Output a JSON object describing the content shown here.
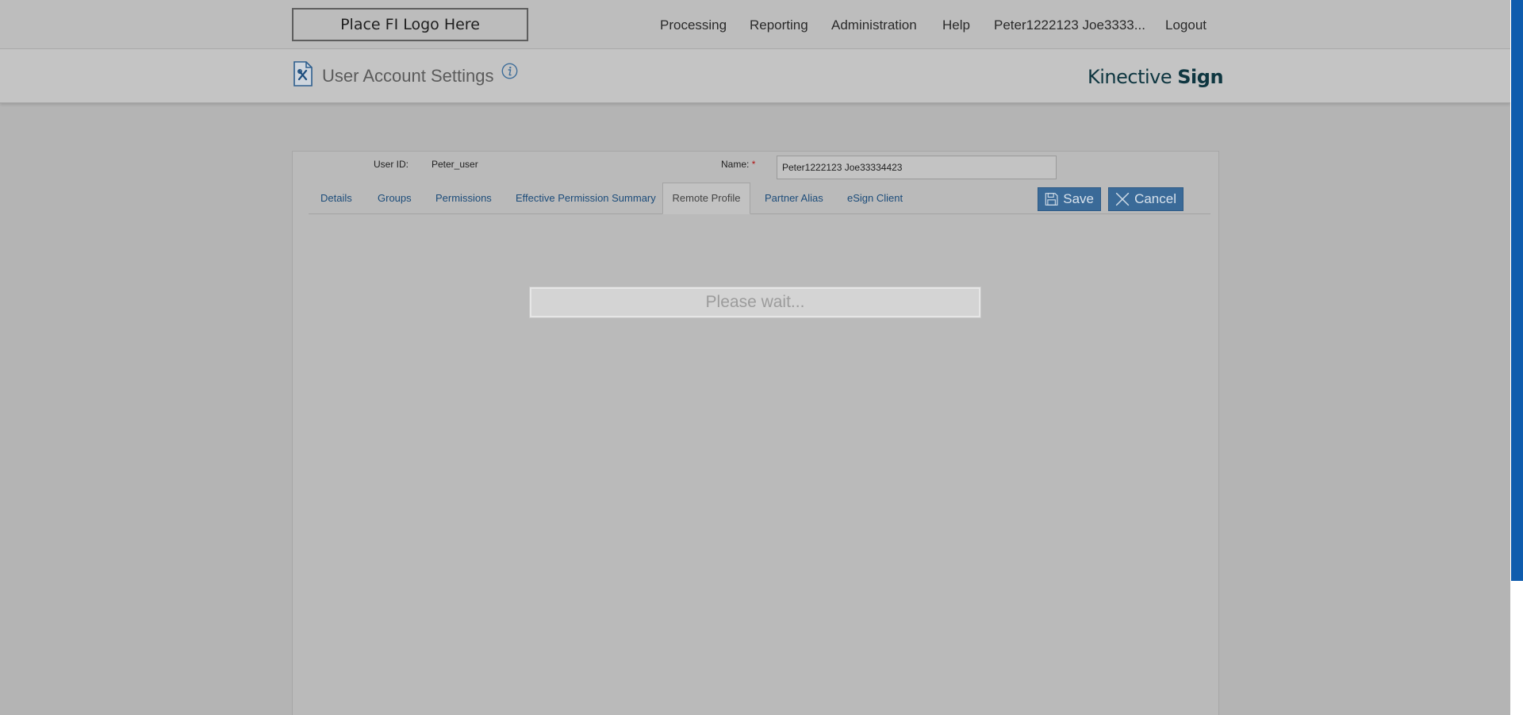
{
  "topbar": {
    "logo_text": "Place FI Logo Here",
    "nav": [
      {
        "label": "Processing"
      },
      {
        "label": "Reporting"
      },
      {
        "label": "Administration"
      },
      {
        "label": "Help"
      },
      {
        "label": "Peter1222123 Joe3333..."
      },
      {
        "label": "Logout"
      }
    ]
  },
  "header": {
    "title": "User Account Settings",
    "title_icon": "document-settings-icon",
    "info_icon": "info-icon",
    "brand_light": "Kinective",
    "brand_strong": "Sign"
  },
  "form": {
    "user_id_label": "User ID:",
    "user_id_value": "Peter_user",
    "name_label": "Name:",
    "name_required_mark": "*",
    "name_value": "Peter1222123 Joe33334423"
  },
  "tabs": [
    {
      "label": "Details"
    },
    {
      "label": "Groups"
    },
    {
      "label": "Permissions"
    },
    {
      "label": "Effective Permission Summary"
    },
    {
      "label": "Remote Profile",
      "active": true
    },
    {
      "label": "Partner Alias"
    },
    {
      "label": "eSign Client"
    }
  ],
  "actions": {
    "save_label": "Save",
    "save_icon": "floppy-disk-icon",
    "cancel_label": "Cancel",
    "cancel_icon": "close-icon"
  },
  "loading": {
    "message": "Please wait..."
  },
  "colors": {
    "accent": "#3a6a98",
    "tab_link": "#1c4c7a",
    "scrollbar_thumb": "#0f5cad",
    "brand": "#0e3640",
    "required": "#b01515"
  }
}
